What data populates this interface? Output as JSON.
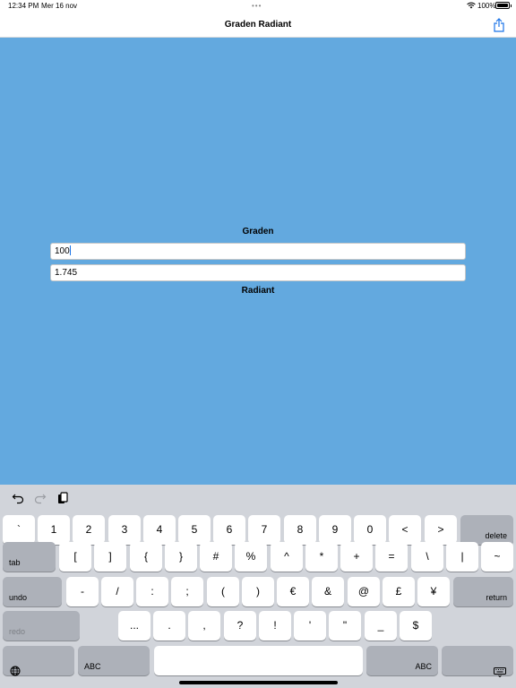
{
  "status": {
    "time": "12:34 PM",
    "date": "Mer 16 nov",
    "dots": "•••",
    "battery": "100%"
  },
  "nav": {
    "title": "Graden Radiant"
  },
  "form": {
    "graden_label": "Graden",
    "graden_value": "100",
    "radiant_value": "1.745",
    "radiant_label": "Radiant"
  },
  "keyboard": {
    "row1": [
      "`",
      "1",
      "2",
      "3",
      "4",
      "5",
      "6",
      "7",
      "8",
      "9",
      "0",
      "<",
      ">"
    ],
    "delete": "delete",
    "tab": "tab",
    "row2": [
      "[",
      "]",
      "{",
      "}",
      "#",
      "%",
      "^",
      "*",
      "+",
      "=",
      "\\",
      "|",
      "~"
    ],
    "undo": "undo",
    "row3": [
      "-",
      "/",
      ":",
      ";",
      "(",
      ")",
      "€",
      "&",
      "@",
      "£",
      "¥"
    ],
    "return": "return",
    "redo": "redo",
    "row4": [
      "...",
      ".",
      ",",
      "?",
      "!",
      "'",
      "\"",
      "_",
      "$"
    ],
    "abc_left": "ABC",
    "abc_right": "ABC"
  },
  "icons": {
    "share": "share-icon",
    "undo": "undo-arrow-icon",
    "redo": "redo-arrow-icon",
    "clipboard": "paste-icon",
    "globe": "globe-icon",
    "dismiss": "keyboard-dismiss-icon",
    "wifi": "wifi-icon"
  },
  "colors": {
    "background": "#63a9df",
    "keyboard": "#d1d4da",
    "key_dark": "#adb1b9",
    "accent": "#1a73e8"
  }
}
